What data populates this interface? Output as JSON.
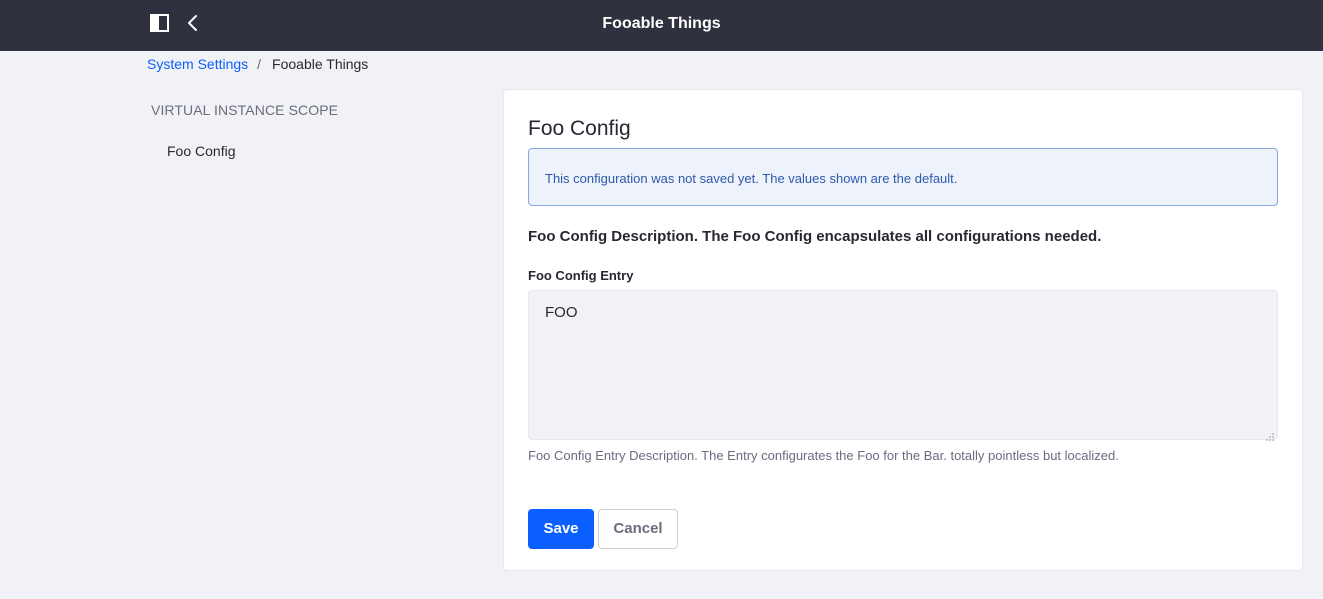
{
  "header": {
    "title": "Fooable Things",
    "panel_toggle_icon": "sidebar-panel-icon",
    "back_icon": "chevron-left-icon",
    "background": "#30313f"
  },
  "breadcrumb": {
    "items": [
      "System Settings",
      "Fooable Things"
    ],
    "separator": "/"
  },
  "sidebar": {
    "scope_label": "VIRTUAL INSTANCE SCOPE",
    "items": [
      {
        "label": "Foo Config"
      }
    ]
  },
  "main": {
    "heading": "Foo Config",
    "alert": "This configuration was not saved yet. The values shown are the default.",
    "description": "Foo Config Description. The Foo Config encapsulates all configurations needed.",
    "field": {
      "label": "Foo Config Entry",
      "value": "FOO",
      "help": "Foo Config Entry Description. The Entry configurates the Foo for the Bar. totally pointless but localized."
    },
    "buttons": {
      "save": "Save",
      "cancel": "Cancel"
    }
  },
  "colors": {
    "accent": "#0b5fff",
    "alert_bg": "#eef2fa",
    "alert_border": "#89a7e0",
    "alert_text": "#2e5aac",
    "page_bg": "#f1f2f5"
  }
}
